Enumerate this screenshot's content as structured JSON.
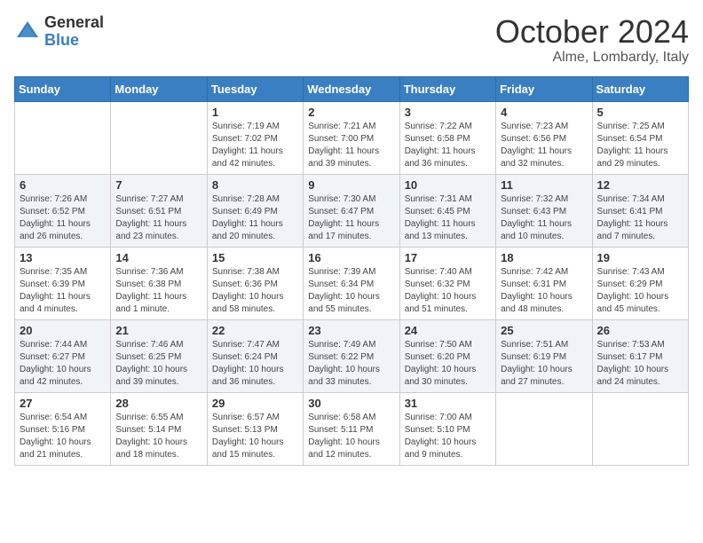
{
  "header": {
    "logo_general": "General",
    "logo_blue": "Blue",
    "month": "October 2024",
    "location": "Alme, Lombardy, Italy"
  },
  "days_of_week": [
    "Sunday",
    "Monday",
    "Tuesday",
    "Wednesday",
    "Thursday",
    "Friday",
    "Saturday"
  ],
  "weeks": [
    [
      {
        "day": "",
        "info": ""
      },
      {
        "day": "",
        "info": ""
      },
      {
        "day": "1",
        "info": "Sunrise: 7:19 AM\nSunset: 7:02 PM\nDaylight: 11 hours and 42 minutes."
      },
      {
        "day": "2",
        "info": "Sunrise: 7:21 AM\nSunset: 7:00 PM\nDaylight: 11 hours and 39 minutes."
      },
      {
        "day": "3",
        "info": "Sunrise: 7:22 AM\nSunset: 6:58 PM\nDaylight: 11 hours and 36 minutes."
      },
      {
        "day": "4",
        "info": "Sunrise: 7:23 AM\nSunset: 6:56 PM\nDaylight: 11 hours and 32 minutes."
      },
      {
        "day": "5",
        "info": "Sunrise: 7:25 AM\nSunset: 6:54 PM\nDaylight: 11 hours and 29 minutes."
      }
    ],
    [
      {
        "day": "6",
        "info": "Sunrise: 7:26 AM\nSunset: 6:52 PM\nDaylight: 11 hours and 26 minutes."
      },
      {
        "day": "7",
        "info": "Sunrise: 7:27 AM\nSunset: 6:51 PM\nDaylight: 11 hours and 23 minutes."
      },
      {
        "day": "8",
        "info": "Sunrise: 7:28 AM\nSunset: 6:49 PM\nDaylight: 11 hours and 20 minutes."
      },
      {
        "day": "9",
        "info": "Sunrise: 7:30 AM\nSunset: 6:47 PM\nDaylight: 11 hours and 17 minutes."
      },
      {
        "day": "10",
        "info": "Sunrise: 7:31 AM\nSunset: 6:45 PM\nDaylight: 11 hours and 13 minutes."
      },
      {
        "day": "11",
        "info": "Sunrise: 7:32 AM\nSunset: 6:43 PM\nDaylight: 11 hours and 10 minutes."
      },
      {
        "day": "12",
        "info": "Sunrise: 7:34 AM\nSunset: 6:41 PM\nDaylight: 11 hours and 7 minutes."
      }
    ],
    [
      {
        "day": "13",
        "info": "Sunrise: 7:35 AM\nSunset: 6:39 PM\nDaylight: 11 hours and 4 minutes."
      },
      {
        "day": "14",
        "info": "Sunrise: 7:36 AM\nSunset: 6:38 PM\nDaylight: 11 hours and 1 minute."
      },
      {
        "day": "15",
        "info": "Sunrise: 7:38 AM\nSunset: 6:36 PM\nDaylight: 10 hours and 58 minutes."
      },
      {
        "day": "16",
        "info": "Sunrise: 7:39 AM\nSunset: 6:34 PM\nDaylight: 10 hours and 55 minutes."
      },
      {
        "day": "17",
        "info": "Sunrise: 7:40 AM\nSunset: 6:32 PM\nDaylight: 10 hours and 51 minutes."
      },
      {
        "day": "18",
        "info": "Sunrise: 7:42 AM\nSunset: 6:31 PM\nDaylight: 10 hours and 48 minutes."
      },
      {
        "day": "19",
        "info": "Sunrise: 7:43 AM\nSunset: 6:29 PM\nDaylight: 10 hours and 45 minutes."
      }
    ],
    [
      {
        "day": "20",
        "info": "Sunrise: 7:44 AM\nSunset: 6:27 PM\nDaylight: 10 hours and 42 minutes."
      },
      {
        "day": "21",
        "info": "Sunrise: 7:46 AM\nSunset: 6:25 PM\nDaylight: 10 hours and 39 minutes."
      },
      {
        "day": "22",
        "info": "Sunrise: 7:47 AM\nSunset: 6:24 PM\nDaylight: 10 hours and 36 minutes."
      },
      {
        "day": "23",
        "info": "Sunrise: 7:49 AM\nSunset: 6:22 PM\nDaylight: 10 hours and 33 minutes."
      },
      {
        "day": "24",
        "info": "Sunrise: 7:50 AM\nSunset: 6:20 PM\nDaylight: 10 hours and 30 minutes."
      },
      {
        "day": "25",
        "info": "Sunrise: 7:51 AM\nSunset: 6:19 PM\nDaylight: 10 hours and 27 minutes."
      },
      {
        "day": "26",
        "info": "Sunrise: 7:53 AM\nSunset: 6:17 PM\nDaylight: 10 hours and 24 minutes."
      }
    ],
    [
      {
        "day": "27",
        "info": "Sunrise: 6:54 AM\nSunset: 5:16 PM\nDaylight: 10 hours and 21 minutes."
      },
      {
        "day": "28",
        "info": "Sunrise: 6:55 AM\nSunset: 5:14 PM\nDaylight: 10 hours and 18 minutes."
      },
      {
        "day": "29",
        "info": "Sunrise: 6:57 AM\nSunset: 5:13 PM\nDaylight: 10 hours and 15 minutes."
      },
      {
        "day": "30",
        "info": "Sunrise: 6:58 AM\nSunset: 5:11 PM\nDaylight: 10 hours and 12 minutes."
      },
      {
        "day": "31",
        "info": "Sunrise: 7:00 AM\nSunset: 5:10 PM\nDaylight: 10 hours and 9 minutes."
      },
      {
        "day": "",
        "info": ""
      },
      {
        "day": "",
        "info": ""
      }
    ]
  ]
}
